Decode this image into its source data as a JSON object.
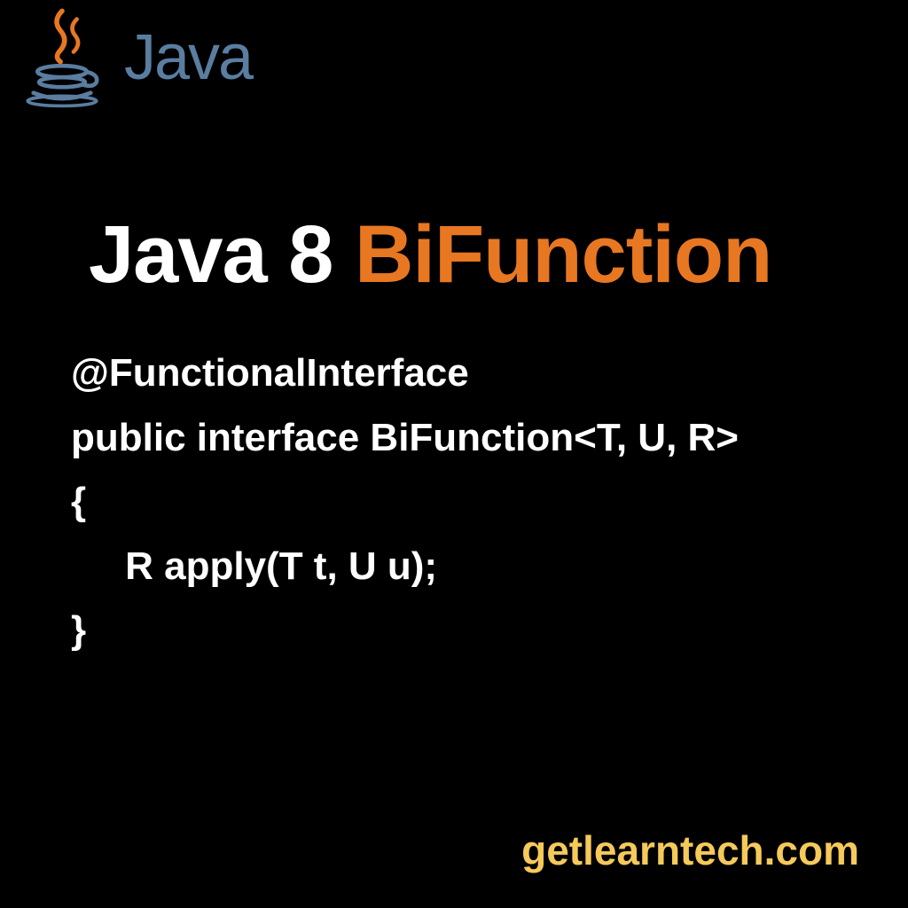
{
  "logo": {
    "text": "Java"
  },
  "title": {
    "part1": "Java 8 ",
    "part2": "BiFunction"
  },
  "code": {
    "line1": "@FunctionalInterface",
    "line2": "public interface BiFunction<T, U, R>",
    "line3": "{",
    "line4": "     R apply(T t, U u);",
    "line5": "}"
  },
  "footer": {
    "url": "getlearntech.com"
  }
}
